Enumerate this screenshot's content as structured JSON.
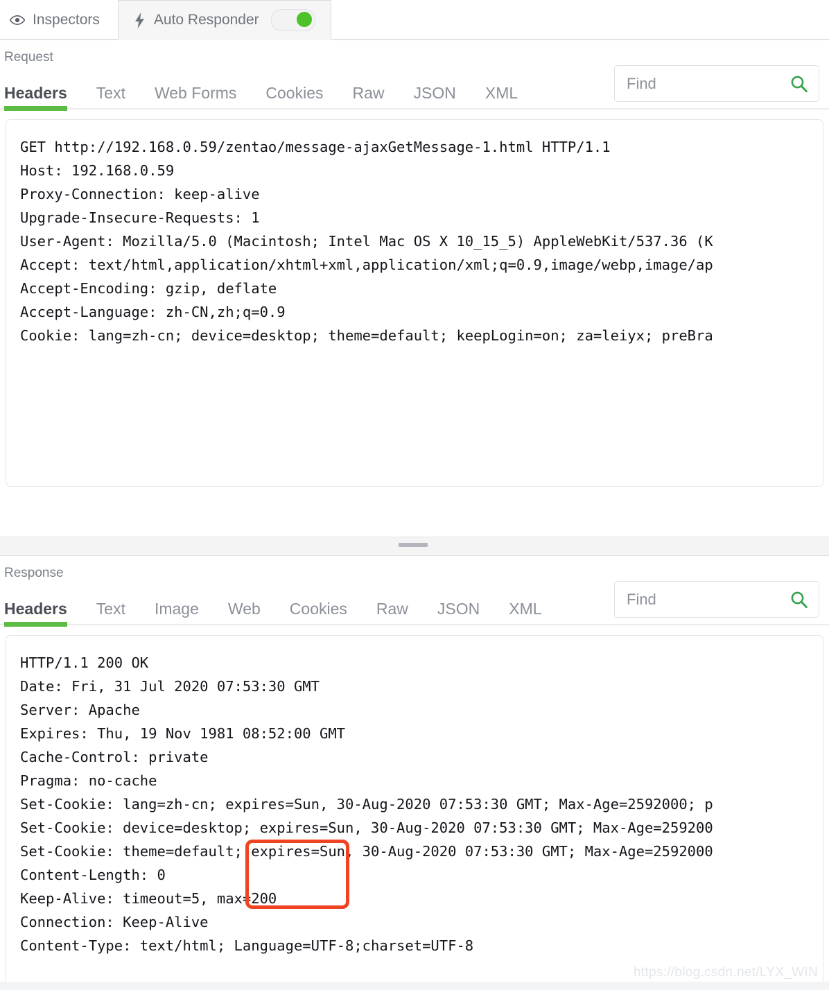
{
  "topbar": {
    "inspectors_label": "Inspectors",
    "auto_responder_label": "Auto Responder",
    "auto_responder_toggle_state": "on"
  },
  "request": {
    "pane_title": "Request",
    "tabs": [
      {
        "label": "Headers",
        "active": true
      },
      {
        "label": "Text",
        "active": false
      },
      {
        "label": "Web Forms",
        "active": false
      },
      {
        "label": "Cookies",
        "active": false
      },
      {
        "label": "Raw",
        "active": false
      },
      {
        "label": "JSON",
        "active": false
      },
      {
        "label": "XML",
        "active": false
      }
    ],
    "find_placeholder": "Find",
    "find_value": "",
    "headers_text": "GET http://192.168.0.59/zentao/message-ajaxGetMessage-1.html HTTP/1.1\nHost: 192.168.0.59\nProxy-Connection: keep-alive\nUpgrade-Insecure-Requests: 1\nUser-Agent: Mozilla/5.0 (Macintosh; Intel Mac OS X 10_15_5) AppleWebKit/537.36 (K\nAccept: text/html,application/xhtml+xml,application/xml;q=0.9,image/webp,image/ap\nAccept-Encoding: gzip, deflate\nAccept-Language: zh-CN,zh;q=0.9\nCookie: lang=zh-cn; device=desktop; theme=default; keepLogin=on; za=leiyx; preBra"
  },
  "response": {
    "pane_title": "Response",
    "tabs": [
      {
        "label": "Headers",
        "active": true
      },
      {
        "label": "Text",
        "active": false
      },
      {
        "label": "Image",
        "active": false
      },
      {
        "label": "Web",
        "active": false
      },
      {
        "label": "Cookies",
        "active": false
      },
      {
        "label": "Raw",
        "active": false
      },
      {
        "label": "JSON",
        "active": false
      },
      {
        "label": "XML",
        "active": false
      }
    ],
    "find_placeholder": "Find",
    "find_value": "",
    "headers_text": "HTTP/1.1 200 OK\nDate: Fri, 31 Jul 2020 07:53:30 GMT\nServer: Apache\nExpires: Thu, 19 Nov 1981 08:52:00 GMT\nCache-Control: private\nPragma: no-cache\nSet-Cookie: lang=zh-cn; expires=Sun, 30-Aug-2020 07:53:30 GMT; Max-Age=2592000; p\nSet-Cookie: device=desktop; expires=Sun, 30-Aug-2020 07:53:30 GMT; Max-Age=259200\nSet-Cookie: theme=default; expires=Sun, 30-Aug-2020 07:53:30 GMT; Max-Age=2592000\nContent-Length: 0\nKeep-Alive: timeout=5, max=200\nConnection: Keep-Alive\nContent-Type: text/html; Language=UTF-8;charset=UTF-8"
  },
  "annotation": {
    "highlighted_value": "max=200",
    "color": "#ee4422"
  },
  "watermark": {
    "text": "https://blog.csdn.net/LYX_WIN"
  }
}
